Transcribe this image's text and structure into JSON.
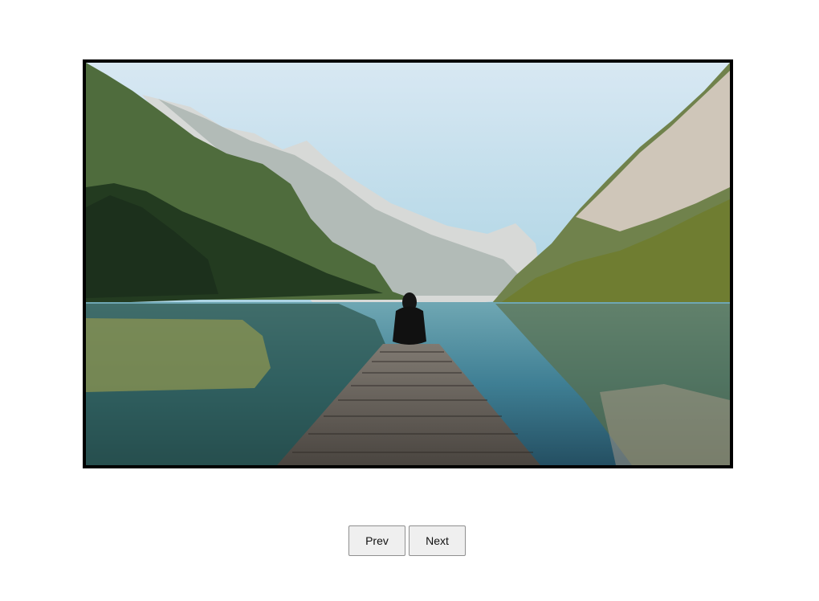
{
  "slideshow": {
    "image_description_icon": "landscape-photo",
    "colors": {
      "sky_top": "#cfe4f0",
      "sky_bottom": "#8fc6d9",
      "frame": "#000000",
      "water": "#3f7f94",
      "forest": "#3b5a2a",
      "dock": "#6f6a64"
    },
    "controls": {
      "prev_label": "Prev",
      "next_label": "Next"
    }
  }
}
